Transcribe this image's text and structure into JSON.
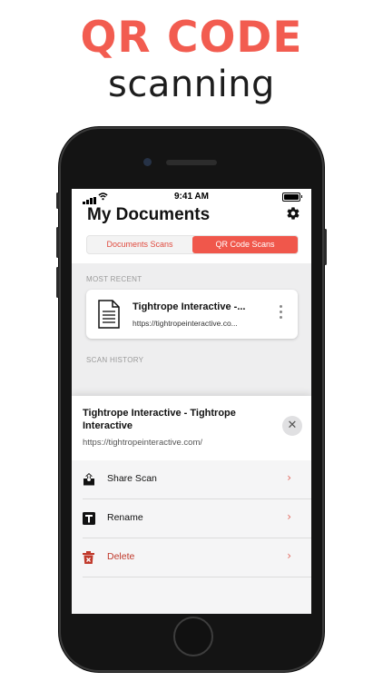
{
  "promo": {
    "title": "QR CODE",
    "subtitle": "scanning",
    "title_color": "#f25c50"
  },
  "status_bar": {
    "time": "9:41 AM"
  },
  "header": {
    "title": "My Documents",
    "settings_icon": "gear-icon"
  },
  "segmented_control": {
    "options": [
      "Documents Scans",
      "QR Code Scans"
    ],
    "selected": "QR Code Scans",
    "accent_color": "#f0574b"
  },
  "sections": {
    "most_recent_label": "MOST RECENT",
    "scan_history_label": "SCAN HISTORY"
  },
  "recent_item": {
    "title": "Tightrope Interactive -...",
    "url": "https://tightropeinteractive.co...",
    "icon": "document-icon"
  },
  "action_sheet": {
    "title": "Tightrope Interactive - Tightrope Interactive",
    "url": "https://tightropeinteractive.com/",
    "close_glyph": "✕",
    "actions": [
      {
        "label": "Share Scan",
        "icon": "share-icon"
      },
      {
        "label": "Rename",
        "icon": "text-icon"
      },
      {
        "label": "Delete",
        "icon": "trash-icon",
        "color": "#c0392b"
      }
    ],
    "chevron": "›"
  }
}
